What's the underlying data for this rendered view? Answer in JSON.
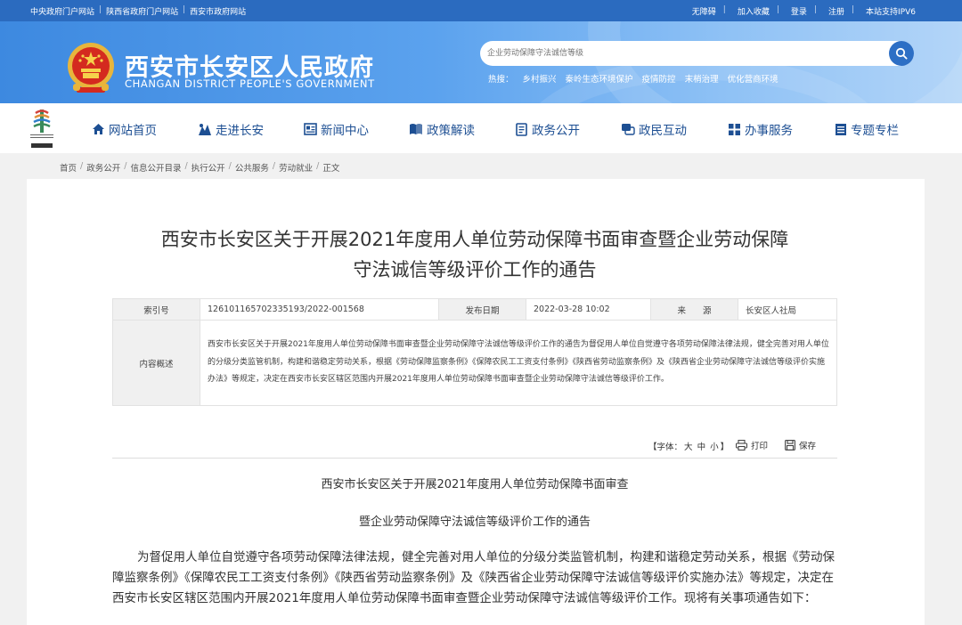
{
  "topbar": {
    "links": [
      "中央政府门户网站",
      "陕西省政府门户网站",
      "西安市政府网站"
    ],
    "right_links": [
      "无障碍",
      "加入收藏",
      "登录",
      "注册",
      "本站支持IPV6"
    ]
  },
  "header": {
    "title": "西安市长安区人民政府",
    "subtitle": "CHANGAN DISTRICT PEOPLE'S GOVERNMENT",
    "search_placeholder": "企业劳动保障守法诚信等级",
    "hot_label": "热搜：",
    "hot_words": [
      "乡村振兴",
      "秦岭生态环境保护",
      "疫情防控",
      "末梢治理",
      "优化营商环境"
    ]
  },
  "nav": {
    "items": [
      "网站首页",
      "走进长安",
      "新闻中心",
      "政策解读",
      "政务公开",
      "政民互动",
      "办事服务",
      "专题专栏"
    ]
  },
  "breadcrumb": [
    "首页",
    "政务公开",
    "信息公开目录",
    "执行公开",
    "公共服务",
    "劳动就业",
    "正文"
  ],
  "article": {
    "title_line1": "西安市长安区关于开展2021年度用人单位劳动保障书面审查暨企业劳动保障",
    "title_line2": "守法诚信等级评价工作的通告",
    "meta": {
      "index_label": "索引号",
      "index_value": "126101165702335193/2022-001568",
      "date_label": "发布日期",
      "date_value": "2022-03-28 10:02",
      "source_label": "来　　源",
      "source_value": "长安区人社局",
      "summary_label": "内容概述",
      "summary": "西安市长安区关于开展2021年度用人单位劳动保障书面审查暨企业劳动保障守法诚信等级评价工作的通告为督促用人单位自觉遵守各项劳动保障法律法规，健全完善对用人单位的分级分类监管机制，构建和谐稳定劳动关系，根据《劳动保障监察条例》《保障农民工工资支付条例》《陕西省劳动监察条例》及《陕西省企业劳动保障守法诚信等级评价实施办法》等规定，决定在西安市长安区辖区范围内开展2021年度用人单位劳动保障书面审查暨企业劳动保障守法诚信等级评价工作。"
    },
    "tools": {
      "font_prefix": "【字体：",
      "font_large": "大",
      "font_medium": "中",
      "font_small": "小",
      "font_suffix": "】",
      "print": "打印",
      "save": "保存"
    },
    "body_heading1": "西安市长安区关于开展2021年度用人单位劳动保障书面审查",
    "body_heading2": "暨企业劳动保障守法诚信等级评价工作的通告",
    "paragraph": "为督促用人单位自觉遵守各项劳动保障法律法规，健全完善对用人单位的分级分类监管机制，构建和谐稳定劳动关系，根据《劳动保障监察条例》《保障农民工工资支付条例》《陕西省劳动监察条例》及《陕西省企业劳动保障守法诚信等级评价实施办法》等规定，决定在西安市长安区辖区范围内开展2021年度用人单位劳动保障书面审查暨企业劳动保障守法诚信等级评价工作。现将有关事项通告如下："
  },
  "colors": {
    "topbar": "#2b6bbf",
    "banner": "#4a93e6",
    "nav_text": "#1d4f93"
  }
}
